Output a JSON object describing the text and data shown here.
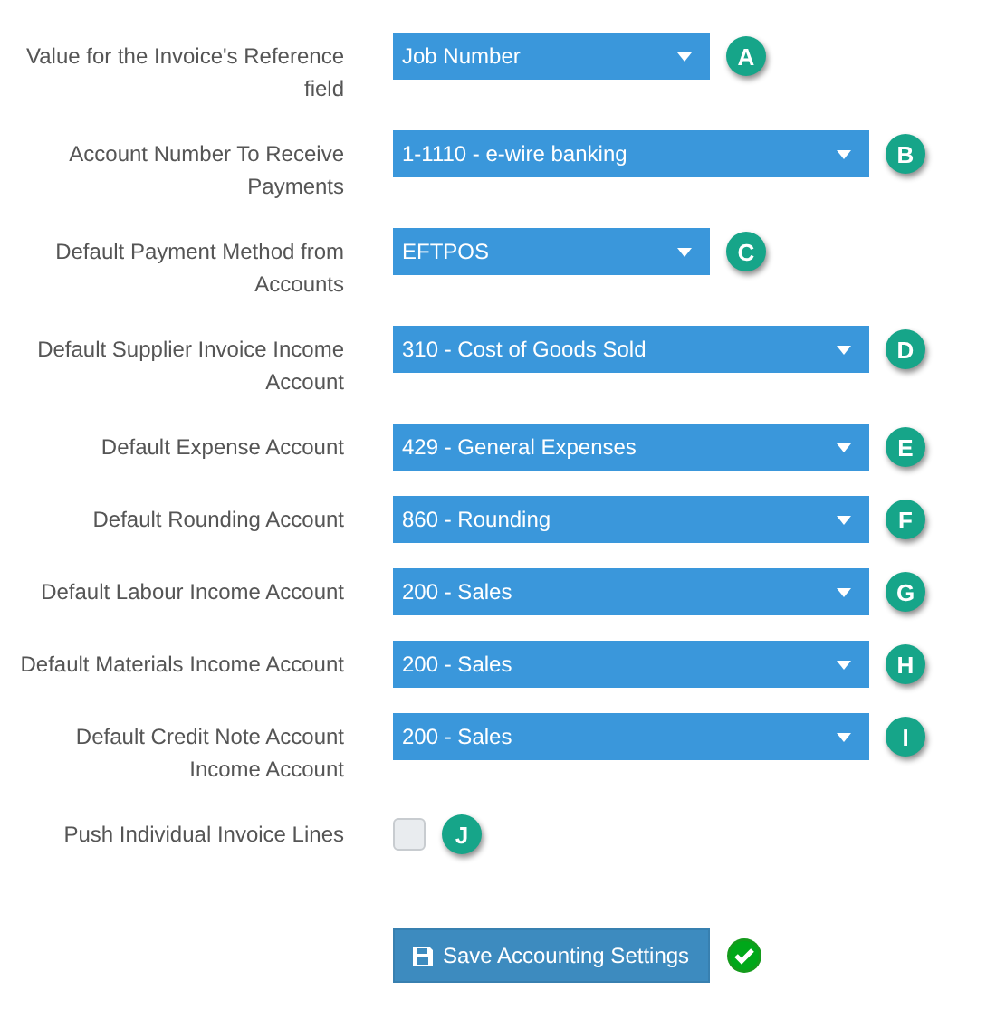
{
  "settings": [
    {
      "kind": "select",
      "label": "Value for the Invoice's Reference field",
      "value": "Job Number",
      "wide": false,
      "badge": "A"
    },
    {
      "kind": "select",
      "label": "Account Number To Receive Payments",
      "value": "1-1110 - e-wire banking",
      "wide": true,
      "badge": "B"
    },
    {
      "kind": "select",
      "label": "Default Payment Method from Accounts",
      "value": "EFTPOS",
      "wide": false,
      "badge": "C"
    },
    {
      "kind": "select",
      "label": "Default Supplier Invoice Income Account",
      "value": "310 - Cost of Goods Sold",
      "wide": true,
      "badge": "D"
    },
    {
      "kind": "select",
      "label": "Default Expense Account",
      "value": "429 - General Expenses",
      "wide": true,
      "badge": "E"
    },
    {
      "kind": "select",
      "label": "Default Rounding Account",
      "value": "860 - Rounding",
      "wide": true,
      "badge": "F"
    },
    {
      "kind": "select",
      "label": "Default Labour Income Account",
      "value": "200 - Sales",
      "wide": true,
      "badge": "G"
    },
    {
      "kind": "select",
      "label": "Default Materials Income Account",
      "value": "200 - Sales",
      "wide": true,
      "badge": "H"
    },
    {
      "kind": "select",
      "label": "Default Credit Note Account Income Account",
      "value": "200 - Sales",
      "wide": true,
      "badge": "I"
    },
    {
      "kind": "checkbox",
      "label": "Push Individual Invoice Lines",
      "checked": false,
      "badge": "J"
    }
  ],
  "save_button": {
    "label": "Save Accounting Settings",
    "saved": true
  }
}
